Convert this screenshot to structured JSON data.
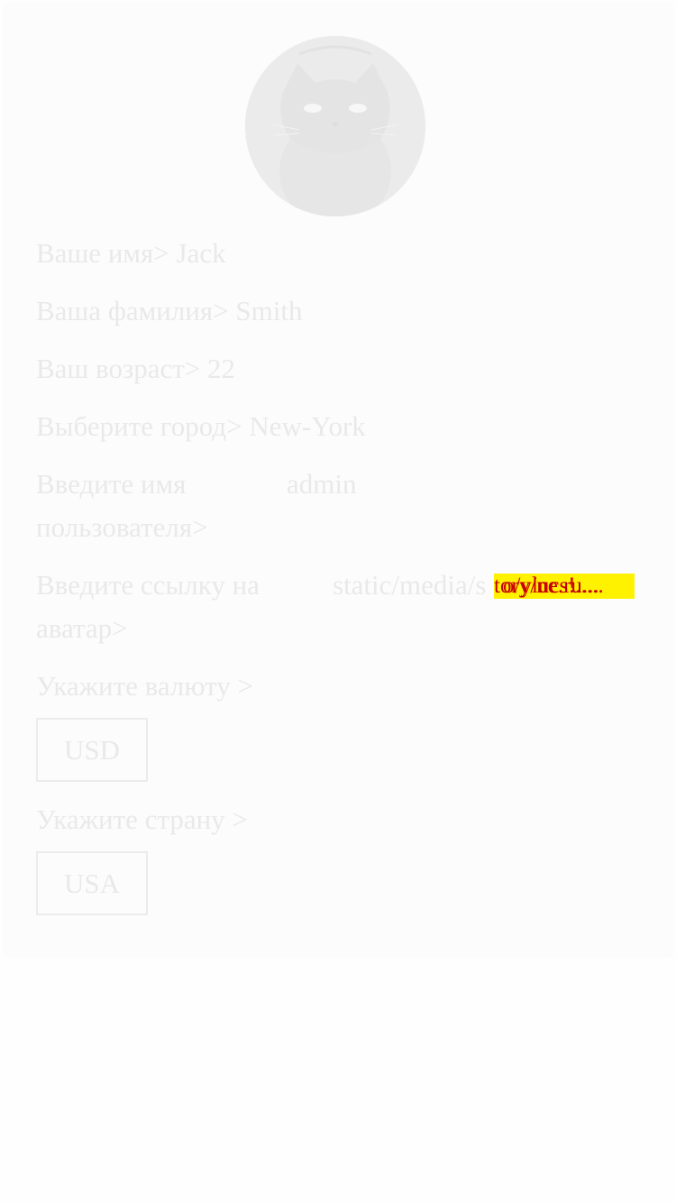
{
  "profile": {
    "avatar_icon": "black-cat-avatar",
    "first_name_label": "Ваше имя>",
    "first_name_value": "Jack",
    "last_name_label": "Ваша фамилия>",
    "last_name_value": "Smith",
    "age_label": "Ваш возраст>",
    "age_value": "22",
    "city_label": "Выберите город>",
    "city_value": "New-York",
    "username_label": "Введите имя пользователя>",
    "username_value": "admin",
    "avatar_link_label": "Введите ссылку на аватар>",
    "avatar_link_value": "static/media/s",
    "avatar_link_overflow_a": "tory/ne.ru...",
    "avatar_link_overflow_b": "o/ylucs!.....",
    "currency_label": "Укажите валюту >",
    "currency_value": "USD",
    "country_label": "Укажите страну >",
    "country_value": "USA"
  },
  "colors": {
    "background": "#fefefe",
    "text": "#e9e9e9",
    "overflow_red": "#c00000",
    "overflow_yellow": "#fff200"
  }
}
